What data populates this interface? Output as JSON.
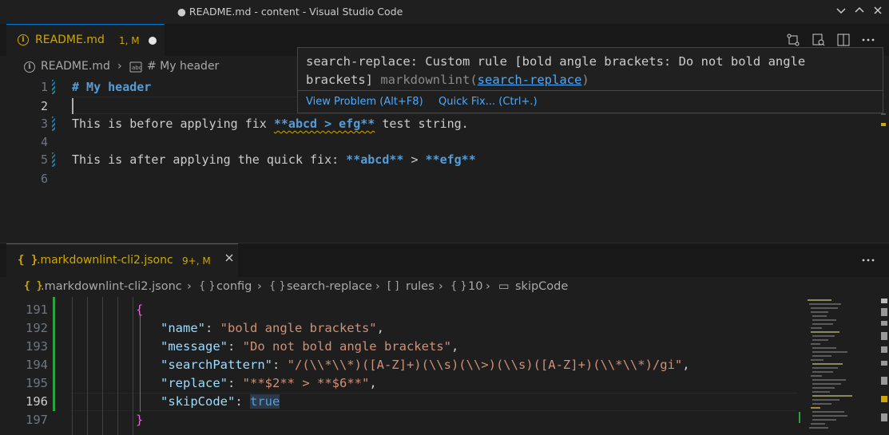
{
  "window": {
    "title": "● README.md - content - Visual Studio Code",
    "controls": [
      "chevron-down",
      "chevron-up",
      "close"
    ]
  },
  "top_group": {
    "tab": {
      "name": "README.md",
      "badge": "1, M",
      "dirty": true
    },
    "breadcrumb": [
      "README.md",
      "# My header"
    ],
    "lines": [
      {
        "num": "1",
        "text": "# My header"
      },
      {
        "num": "2",
        "text": ""
      },
      {
        "num": "3",
        "before": "This is before applying fix ",
        "bold": "**abcd > efg**",
        "after": " test string."
      },
      {
        "num": "4",
        "text": ""
      },
      {
        "num": "5",
        "before": "This is after applying the quick fix: ",
        "bold1": "**abcd**",
        "mid": " > ",
        "bold2": "**efg**"
      },
      {
        "num": "6",
        "text": ""
      }
    ]
  },
  "hover": {
    "message": "search-replace: Custom rule [bold angle brackets: Do not bold angle brackets]",
    "source": "markdownlint(",
    "source_link": "search-replace",
    "source_end": ")",
    "view_problem": "View Problem (Alt+F8)",
    "quick_fix": "Quick Fix... (Ctrl+.)"
  },
  "bottom_group": {
    "tab": {
      "icon": "{ }",
      "name": ".markdownlint-cli2.jsonc",
      "badge": "9+, M"
    },
    "breadcrumb": [
      {
        "icon": "{ }",
        "label": ".markdownlint-cli2.jsonc"
      },
      {
        "icon": "{ }",
        "label": "config"
      },
      {
        "icon": "{ }",
        "label": "search-replace"
      },
      {
        "icon": "[ ]",
        "label": "rules"
      },
      {
        "icon": "{ }",
        "label": "10"
      },
      {
        "icon": "▭",
        "label": "skipCode"
      }
    ],
    "lines": [
      {
        "num": "191",
        "text": "{"
      },
      {
        "num": "192",
        "key": "\"name\"",
        "value": "\"bold angle brackets\""
      },
      {
        "num": "193",
        "key": "\"message\"",
        "value": "\"Do not bold angle brackets\""
      },
      {
        "num": "194",
        "key": "\"searchPattern\"",
        "value": "\"/(\\\\*\\\\*)([A-Z]+)(\\\\s)(\\\\>)(\\\\s)([A-Z]+)(\\\\*\\\\*)/gi\""
      },
      {
        "num": "195",
        "key": "\"replace\"",
        "value": "\"**$2** > **$6**\""
      },
      {
        "num": "196",
        "key": "\"skipCode\"",
        "value": "true"
      },
      {
        "num": "197",
        "text": "}"
      }
    ]
  },
  "colors": {
    "accent": "#0078d4",
    "warning": "#cca700",
    "link": "#4daafc",
    "markdown_bold": "#569cd6",
    "json_key": "#9cdcfe",
    "json_string": "#ce9178",
    "bracket": "#da70d6",
    "added_gutter": "#2ea043"
  }
}
